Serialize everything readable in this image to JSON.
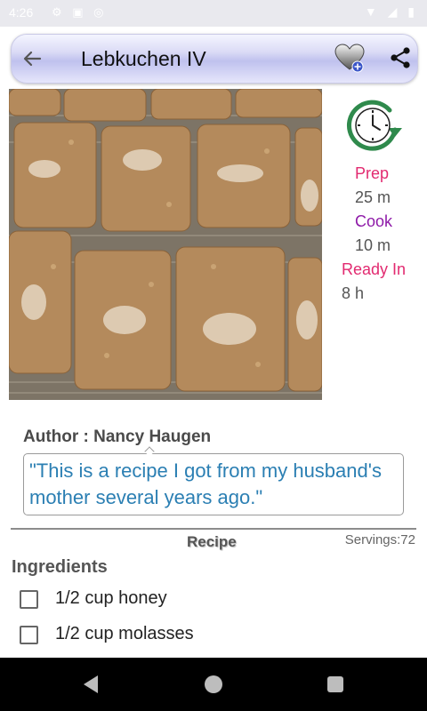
{
  "status_bar": {
    "time": "4:26",
    "left_icons": "⚙ ▣ ◎",
    "right_icons": "▼ ◢ ▮"
  },
  "toolbar": {
    "title": "Lebkuchen IV",
    "back_icon": "arrow-left-icon",
    "favorite_icon": "heart-add-icon",
    "share_icon": "share-icon"
  },
  "times": {
    "prep_label": "Prep",
    "prep_value": "25 m",
    "cook_label": "Cook",
    "cook_value": "10 m",
    "ready_label": "Ready In",
    "ready_value": "8 h"
  },
  "author": "Author : Nancy Haugen",
  "description": "\"This is a recipe I got from my husband's mother several years ago.\"",
  "recipe_label": "Recipe",
  "servings": "Servings:72",
  "ingredients_label": "Ingredients",
  "ingredients": [
    "1/2 cup honey",
    "1/2 cup molasses"
  ],
  "colors": {
    "accent_pink": "#e22a70",
    "accent_purple": "#8e1aa8",
    "quote_blue": "#2b7fb3",
    "clock_green": "#2f8a4c"
  }
}
